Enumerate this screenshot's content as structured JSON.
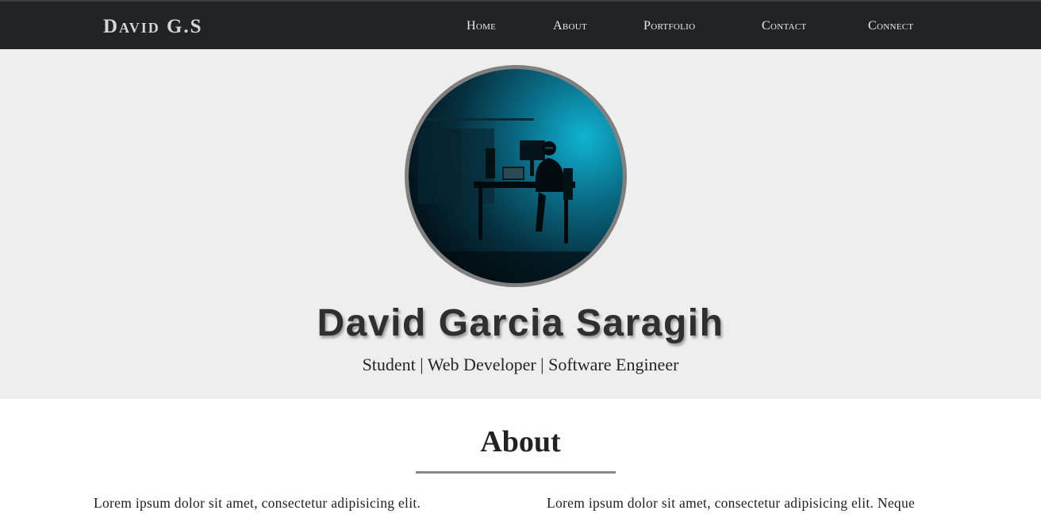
{
  "navbar": {
    "brand": "David G.S",
    "links": [
      {
        "label": "Home"
      },
      {
        "label": "About"
      },
      {
        "label": "Portfolio"
      },
      {
        "label": "Contact"
      },
      {
        "label": "Connect"
      }
    ]
  },
  "hero": {
    "avatar_icon": "person-at-desk-photo",
    "name": "David Garcia Saragih",
    "subtitle": "Student | Web Developer | Software Engineer"
  },
  "about": {
    "title": "About",
    "left_text": "Lorem ipsum dolor sit amet, consectetur adipisicing elit.",
    "right_text": "Lorem ipsum dolor sit amet, consectetur adipisicing elit. Neque"
  },
  "colors": {
    "navbar_bg": "#212424",
    "hero_bg": "#eeeeee",
    "avatar_border": "#7f7f7f",
    "divider": "#8a8a8a"
  }
}
